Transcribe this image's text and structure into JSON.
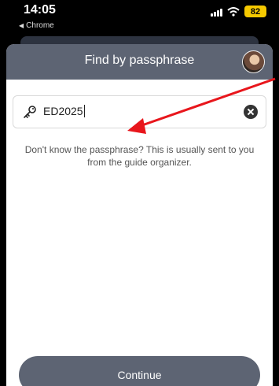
{
  "status_bar": {
    "time": "14:05",
    "back_app": "Chrome",
    "battery": "82"
  },
  "header": {
    "title": "Find by passphrase"
  },
  "search": {
    "value": "ED2025"
  },
  "help_text": "Don't know the passphrase? This is usually sent to you from the guide organizer.",
  "continue_label": "Continue",
  "colors": {
    "header": "#5d6473",
    "annotation_arrow": "#e8161c",
    "battery": "#f5c900"
  }
}
